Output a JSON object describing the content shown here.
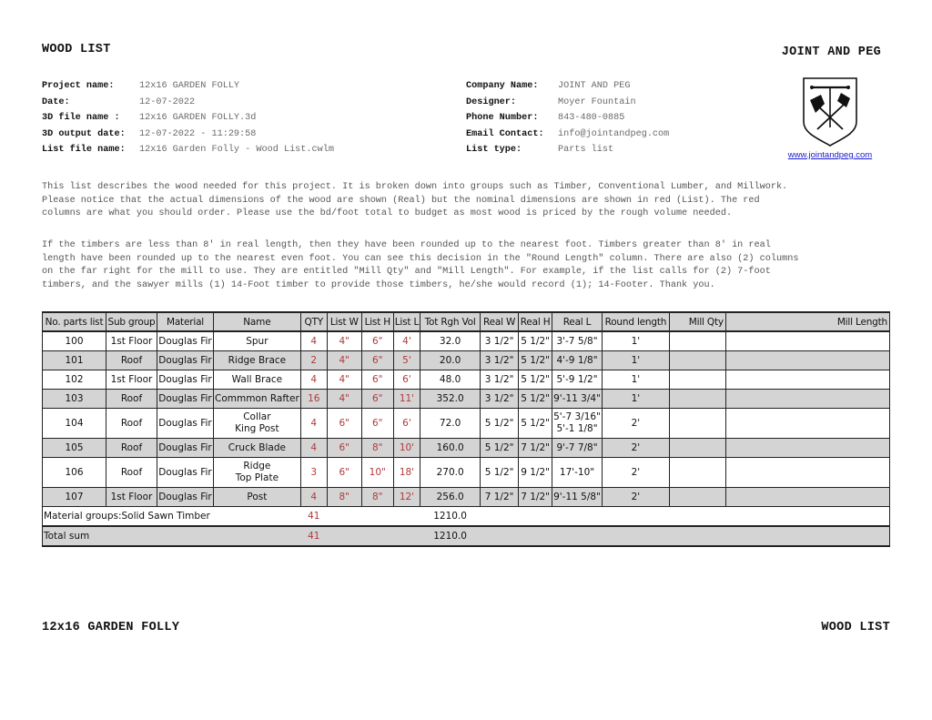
{
  "header": {
    "title": "WOOD LIST",
    "company_heading": "JOINT AND PEG"
  },
  "project_info": [
    {
      "label": "Project name:",
      "value": "12x16 GARDEN FOLLY"
    },
    {
      "label": "Date:",
      "value": "12-07-2022"
    },
    {
      "label": "3D file name :",
      "value": "12x16 GARDEN FOLLY.3d"
    },
    {
      "label": "3D output date:",
      "value": "12-07-2022 - 11:29:58"
    },
    {
      "label": "List file name:",
      "value": "12x16 Garden Folly - Wood List.cwlm"
    }
  ],
  "company_info": [
    {
      "label": "Company Name:",
      "value": "JOINT AND PEG"
    },
    {
      "label": "Designer:",
      "value": "Moyer Fountain"
    },
    {
      "label": "Phone Number:",
      "value": "843-480-0885"
    },
    {
      "label": "Email Contact:",
      "value": "info@jointandpeg.com"
    },
    {
      "label": "List type:",
      "value": "Parts list"
    }
  ],
  "logo": {
    "icon": "shield-axes-logo",
    "link_text": "www.jointandpeg.com"
  },
  "paragraphs": [
    "This list describes the wood needed for this project.  It is broken down into groups such as Timber, Conventional Lumber, and Millwork.\nPlease notice that the actual dimensions of the wood are shown (Real) but the nominal dimensions are shown in red (List).  The red\ncolumns are what you should order.  Please use the bd/foot total to budget as most wood is priced by the rough volume needed.",
    "If the timbers are less than 8' in real length, then they have been rounded up to the nearest foot. Timbers greater than 8' in real\nlength have been rounded up to the nearest even foot. You can see this decision in the \"Round Length\" column. There are also (2) columns\non the far right for the mill to use. They are entitled \"Mill Qty\" and \"Mill Length\". For example, if the list calls for (2) 7-foot\ntimbers, and the sawyer mills (1) 14-Foot timber to provide those timbers, he/she would record (1); 14-Footer. Thank you."
  ],
  "colors": {
    "list_red": "#b13a3a",
    "row_alt_gray": "#d4d4d4",
    "link_blue": "#1a1ad0"
  },
  "table": {
    "columns": [
      "No. parts list",
      "Sub group",
      "Material",
      "Name",
      "QTY",
      "List W",
      "List H",
      "List L",
      "Tot Rgh Vol",
      "Real W",
      "Real H",
      "Real L",
      "Round length",
      "Mill Qty",
      "Mill Length"
    ],
    "rows": [
      {
        "no": "100",
        "sub": "1st Floor",
        "mat": "Douglas Fir",
        "name1": "Spur",
        "name2": "",
        "qty": "4",
        "lw": "4\"",
        "lh": "6\"",
        "ll": "4'",
        "vol": "32.0",
        "rw": "3 1/2\"",
        "rh": "5 1/2\"",
        "rl1": "3'-7 5/8\"",
        "rl2": "",
        "round": "1'",
        "mqty": "",
        "mlen": ""
      },
      {
        "no": "101",
        "sub": "Roof",
        "mat": "Douglas Fir",
        "name1": "Ridge Brace",
        "name2": "",
        "qty": "2",
        "lw": "4\"",
        "lh": "6\"",
        "ll": "5'",
        "vol": "20.0",
        "rw": "3 1/2\"",
        "rh": "5 1/2\"",
        "rl1": "4'-9 1/8\"",
        "rl2": "",
        "round": "1'",
        "mqty": "",
        "mlen": ""
      },
      {
        "no": "102",
        "sub": "1st Floor",
        "mat": "Douglas Fir",
        "name1": "Wall Brace",
        "name2": "",
        "qty": "4",
        "lw": "4\"",
        "lh": "6\"",
        "ll": "6'",
        "vol": "48.0",
        "rw": "3 1/2\"",
        "rh": "5 1/2\"",
        "rl1": "5'-9 1/2\"",
        "rl2": "",
        "round": "1'",
        "mqty": "",
        "mlen": ""
      },
      {
        "no": "103",
        "sub": "Roof",
        "mat": "Douglas Fir",
        "name1": "Commmon Rafter",
        "name2": "",
        "qty": "16",
        "lw": "4\"",
        "lh": "6\"",
        "ll": "11'",
        "vol": "352.0",
        "rw": "3 1/2\"",
        "rh": "5 1/2\"",
        "rl1": "9'-11 3/4\"",
        "rl2": "",
        "round": "1'",
        "mqty": "",
        "mlen": ""
      },
      {
        "no": "104",
        "sub": "Roof",
        "mat": "Douglas Fir",
        "name1": "Collar",
        "name2": "King Post",
        "qty": "4",
        "lw": "6\"",
        "lh": "6\"",
        "ll": "6'",
        "vol": "72.0",
        "rw": "5 1/2\"",
        "rh": "5 1/2\"",
        "rl1": "5'-7 3/16\"",
        "rl2": "5'-1 1/8\"",
        "round": "2'",
        "mqty": "",
        "mlen": ""
      },
      {
        "no": "105",
        "sub": "Roof",
        "mat": "Douglas Fir",
        "name1": "Cruck Blade",
        "name2": "",
        "qty": "4",
        "lw": "6\"",
        "lh": "8\"",
        "ll": "10'",
        "vol": "160.0",
        "rw": "5 1/2\"",
        "rh": "7 1/2\"",
        "rl1": "9'-7 7/8\"",
        "rl2": "",
        "round": "2'",
        "mqty": "",
        "mlen": ""
      },
      {
        "no": "106",
        "sub": "Roof",
        "mat": "Douglas Fir",
        "name1": "Ridge",
        "name2": "Top Plate",
        "qty": "3",
        "lw": "6\"",
        "lh": "10\"",
        "ll": "18'",
        "vol": "270.0",
        "rw": "5 1/2\"",
        "rh": "9 1/2\"",
        "rl1": "17'-10\"",
        "rl2": "",
        "round": "2'",
        "mqty": "",
        "mlen": ""
      },
      {
        "no": "107",
        "sub": "1st Floor",
        "mat": "Douglas Fir",
        "name1": "Post",
        "name2": "",
        "qty": "4",
        "lw": "8\"",
        "lh": "8\"",
        "ll": "12'",
        "vol": "256.0",
        "rw": "7 1/2\"",
        "rh": "7 1/2\"",
        "rl1": "9'-11 5/8\"",
        "rl2": "",
        "round": "2'",
        "mqty": "",
        "mlen": ""
      }
    ],
    "group_row": {
      "label": "Material groups:Solid Sawn Timber",
      "qty": "41",
      "vol": "1210.0"
    },
    "total_row": {
      "label": "Total sum",
      "qty": "41",
      "vol": "1210.0"
    }
  },
  "footer": {
    "left": "12x16 GARDEN FOLLY",
    "right": "WOOD LIST"
  }
}
